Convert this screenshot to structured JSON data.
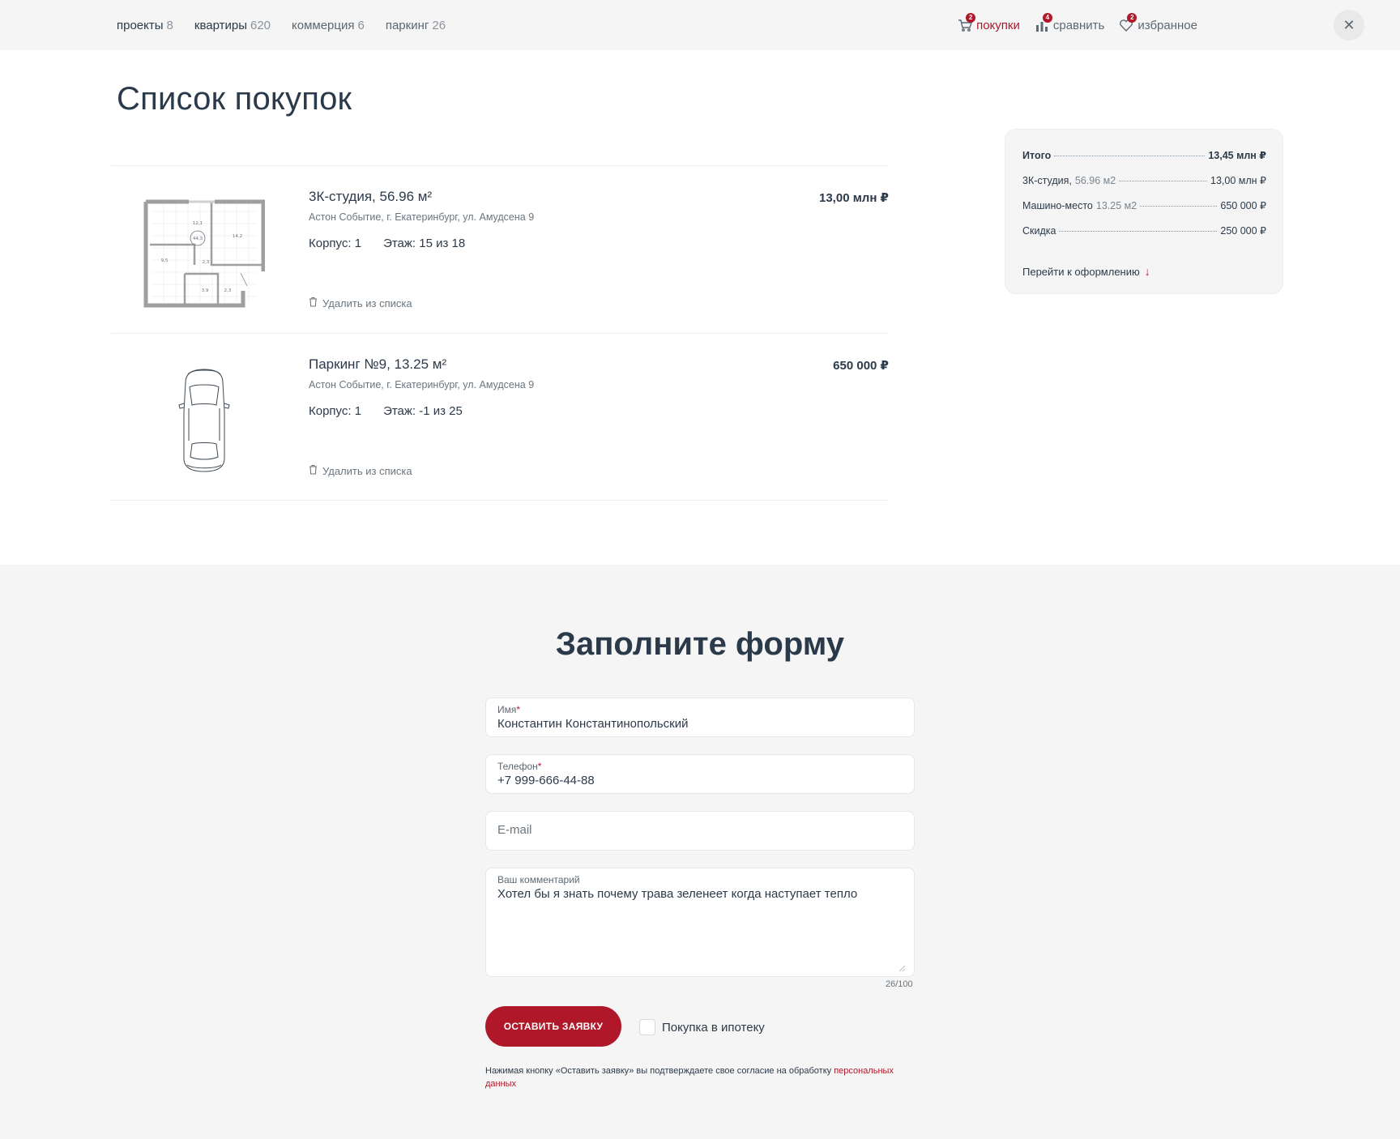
{
  "nav": {
    "tabs": [
      {
        "label": "проекты",
        "count": "8"
      },
      {
        "label": "квартиры",
        "count": "620"
      },
      {
        "label": "коммерция",
        "count": "6"
      },
      {
        "label": "паркинг",
        "count": "26"
      }
    ],
    "actions": [
      {
        "label": "покупки",
        "badge": "2",
        "icon": "cart-icon"
      },
      {
        "label": "сравнить",
        "badge": "4",
        "icon": "compare-icon"
      },
      {
        "label": "избранное",
        "badge": "2",
        "icon": "heart-icon"
      }
    ],
    "close_icon": "close-icon"
  },
  "page": {
    "title": "Список покупок"
  },
  "items": [
    {
      "title": "3К-студия, 56.96 м²",
      "address": "Астон Событие, г. Екатеринбург, ул. Амудсена 9",
      "building": "Корпус: 1",
      "floor": "Этаж: 15 из 18",
      "price": "13,00 млн ₽",
      "delete_label": "Удалить из списка",
      "plan_labels": [
        "12,1",
        "44,3",
        "14,2",
        "9,5",
        "2,3",
        "3,9",
        "2,3"
      ]
    },
    {
      "title": "Паркинг №9, 13.25 м²",
      "address": "Астон Событие, г. Екатеринбург, ул. Амудсена 9",
      "building": "Корпус: 1",
      "floor": "Этаж: -1 из 25",
      "price": "650 000 ₽",
      "delete_label": "Удалить из списка"
    }
  ],
  "summary": {
    "total_label": "Итого",
    "total_value": "13,45 млн ₽",
    "lines": [
      {
        "label": "3К-студия,",
        "muted": "56.96 м2",
        "value": "13,00 млн ₽"
      },
      {
        "label": "Машино-место",
        "muted": "13.25 м2",
        "value": "650 000 ₽"
      },
      {
        "label": "Скидка",
        "muted": "",
        "value": "250 000 ₽"
      }
    ],
    "cta": "Перейти к оформлению"
  },
  "form": {
    "title": "Заполните форму",
    "name": {
      "label": "Имя",
      "required_mark": "*",
      "value": "Константин Константинопольский"
    },
    "phone": {
      "label": "Телефон",
      "required_mark": "*",
      "value": "+7 999-666-44-88"
    },
    "email": {
      "placeholder": "E-mail"
    },
    "comment": {
      "label": "Ваш комментарий",
      "value": "Хотел бы я знать почему трава зеленеет когда наступает тепло",
      "counter": "26/100"
    },
    "submit_label": "ОСТАВИТЬ ЗАЯВКУ",
    "mortgage_label": "Покупка в ипотеку",
    "consent_text": "Нажимая кнопку «Оставить заявку» вы подтверждаете свое согласие на обработку ",
    "consent_link": "персональных данных"
  },
  "colors": {
    "accent": "#b0182a",
    "text": "#2b3a4a",
    "panel": "#f5f5f5"
  }
}
